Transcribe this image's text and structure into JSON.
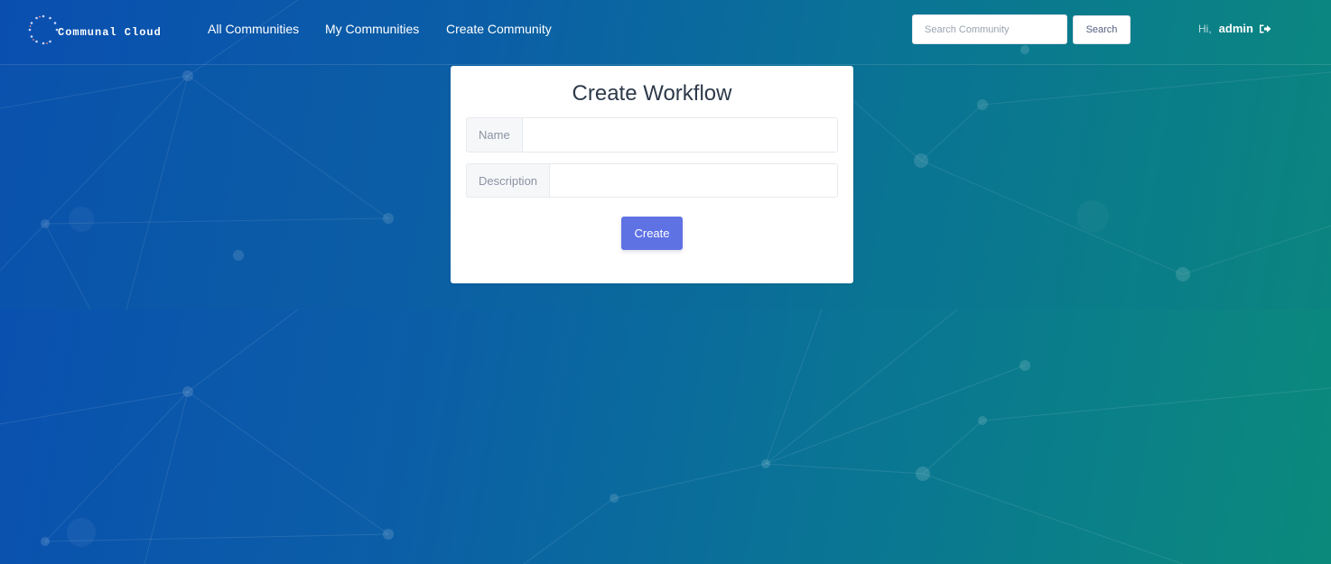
{
  "app": {
    "name": "Communal Cloud"
  },
  "nav": {
    "all_communities": "All Communities",
    "my_communities": "My Communities",
    "create_community": "Create Community"
  },
  "search": {
    "placeholder": "Search Community",
    "value": "",
    "button_label": "Search"
  },
  "user": {
    "greeting": "Hi,",
    "username": "admin",
    "logout_icon": "sign-out-icon"
  },
  "form": {
    "title": "Create Workflow",
    "name_label": "Name",
    "name_value": "",
    "description_label": "Description",
    "description_value": "",
    "submit_label": "Create"
  },
  "colors": {
    "primary_button": "#5e72e4",
    "background_start": "#0a4fb0",
    "background_end": "#0b8a7c"
  }
}
